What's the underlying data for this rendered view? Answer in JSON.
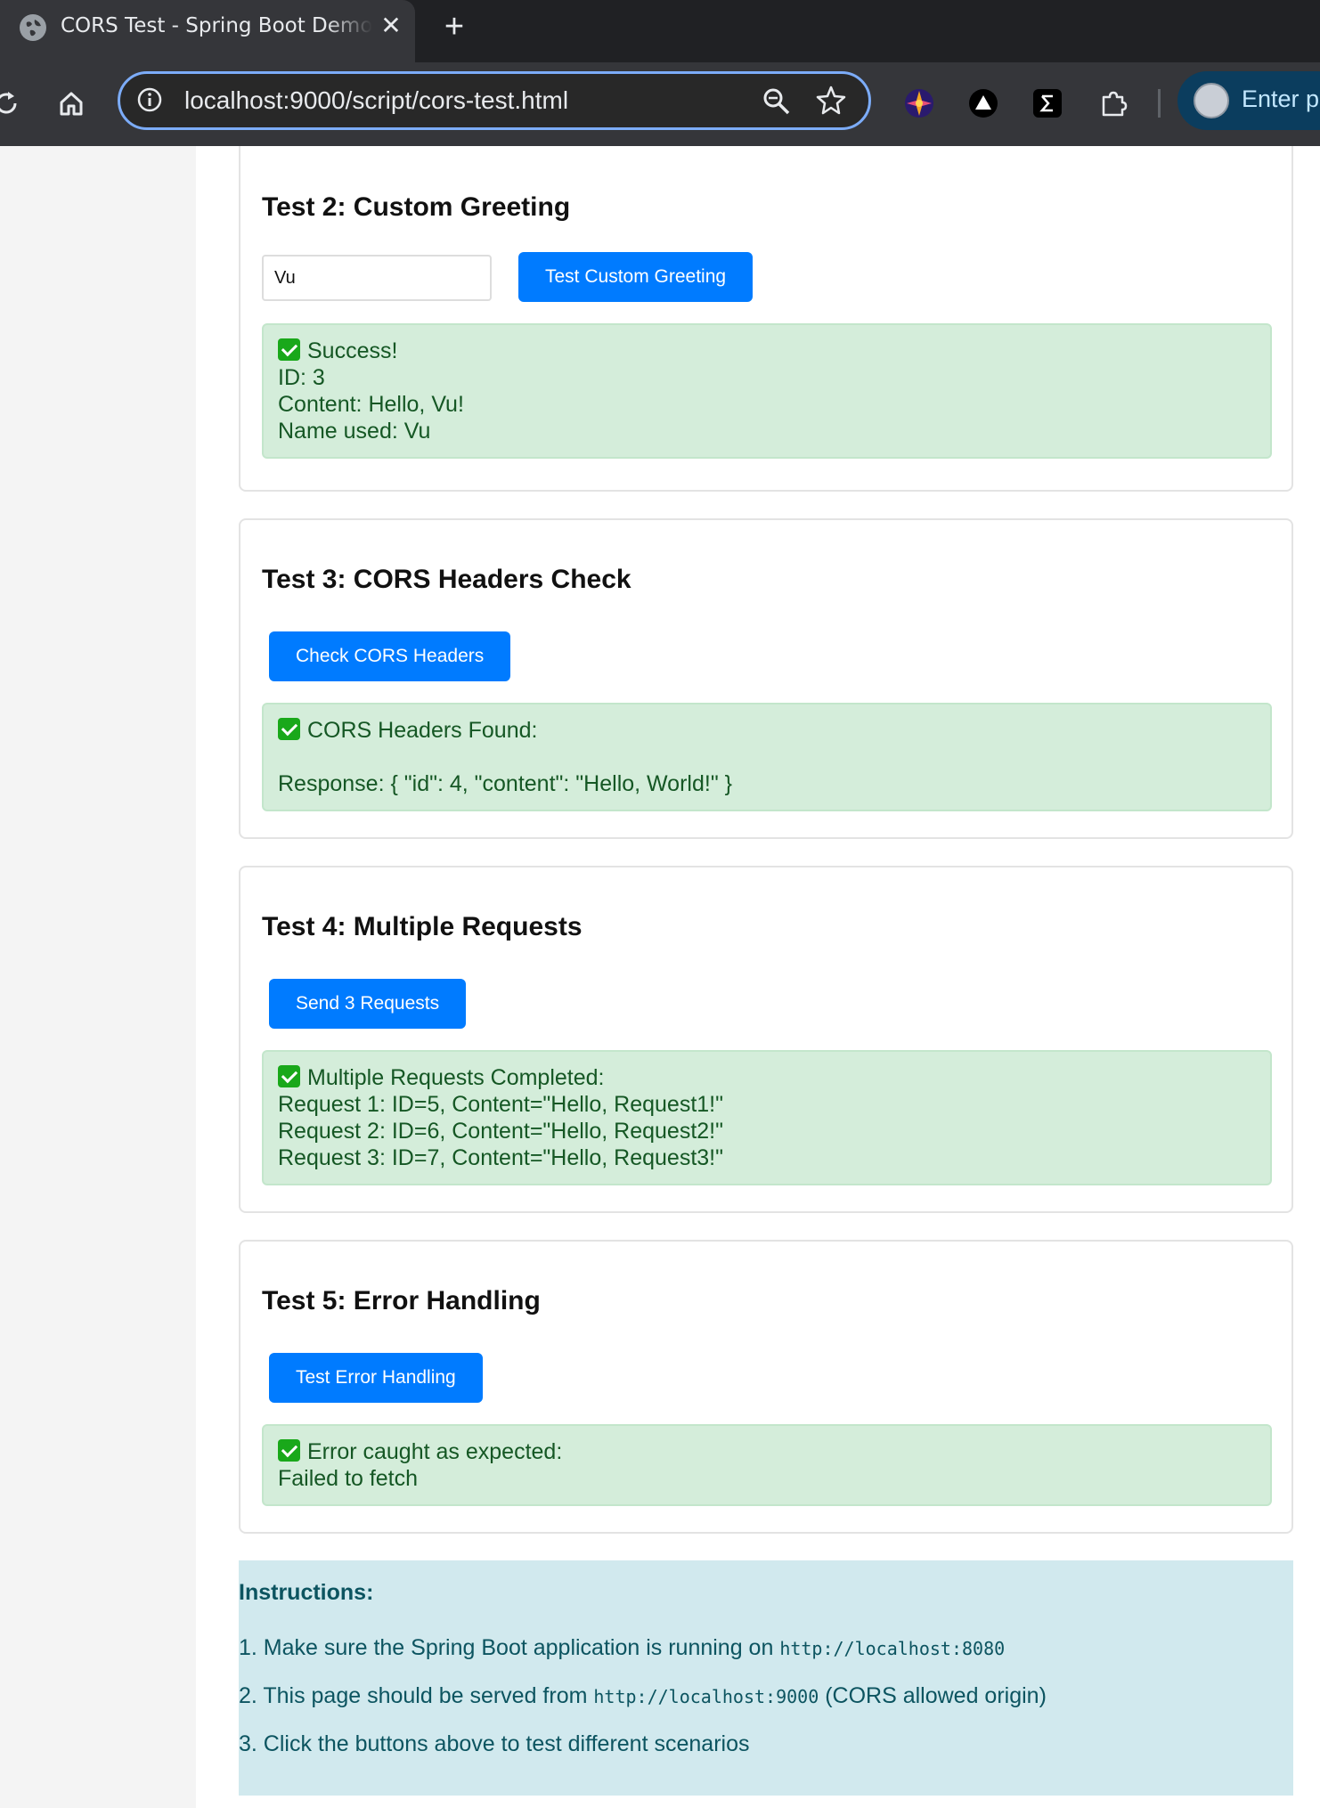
{
  "browser": {
    "tab_title": "CORS Test - Spring Boot Demo",
    "tab_close": "✕",
    "new_tab": "+",
    "url": "localhost:9000/script/cors-test.html",
    "profile_label": "Enter p"
  },
  "tests": {
    "test2": {
      "title": "Test 2: Custom Greeting",
      "input_value": "Vu",
      "button": "Test Custom Greeting",
      "result_heading": "Success!",
      "result_lines": [
        "ID: 3",
        "Content: Hello, Vu!",
        "Name used: Vu"
      ]
    },
    "test3": {
      "title": "Test 3: CORS Headers Check",
      "button": "Check CORS Headers",
      "result_heading": "CORS Headers Found:",
      "result_lines": [
        "Response: { \"id\": 4, \"content\": \"Hello, World!\" }"
      ]
    },
    "test4": {
      "title": "Test 4: Multiple Requests",
      "button": "Send 3 Requests",
      "result_heading": "Multiple Requests Completed:",
      "result_lines": [
        "Request 1: ID=5, Content=\"Hello, Request1!\"",
        "Request 2: ID=6, Content=\"Hello, Request2!\"",
        "Request 3: ID=7, Content=\"Hello, Request3!\""
      ]
    },
    "test5": {
      "title": "Test 5: Error Handling",
      "button": "Test Error Handling",
      "result_heading": "Error caught as expected:",
      "result_lines": [
        "Failed to fetch"
      ]
    }
  },
  "instructions": {
    "title": "Instructions:",
    "step1_text": "1. Make sure the Spring Boot application is running on ",
    "step1_code": "http://localhost:8080",
    "step2_text": "2. This page should be served from ",
    "step2_code": "http://localhost:9000",
    "step2_suffix": " (CORS allowed origin)",
    "step3_text": "3. Click the buttons above to test different scenarios"
  },
  "colors": {
    "primary_button": "#007bff",
    "success_bg": "#d4edda",
    "success_text": "#155724",
    "info_bg": "#d1e9ee",
    "info_text": "#0c5460"
  },
  "icons": {
    "tab_favicon": "globe-icon",
    "reload": "reload-icon",
    "home": "home-icon",
    "site_info": "info-icon",
    "zoom": "zoom-icon",
    "bookmark": "star-icon",
    "extensions": [
      "colorful-extension-icon",
      "triangle-extension-icon",
      "sigma-extension-icon",
      "puzzle-icon"
    ],
    "result_status": "check-mark-icon"
  }
}
